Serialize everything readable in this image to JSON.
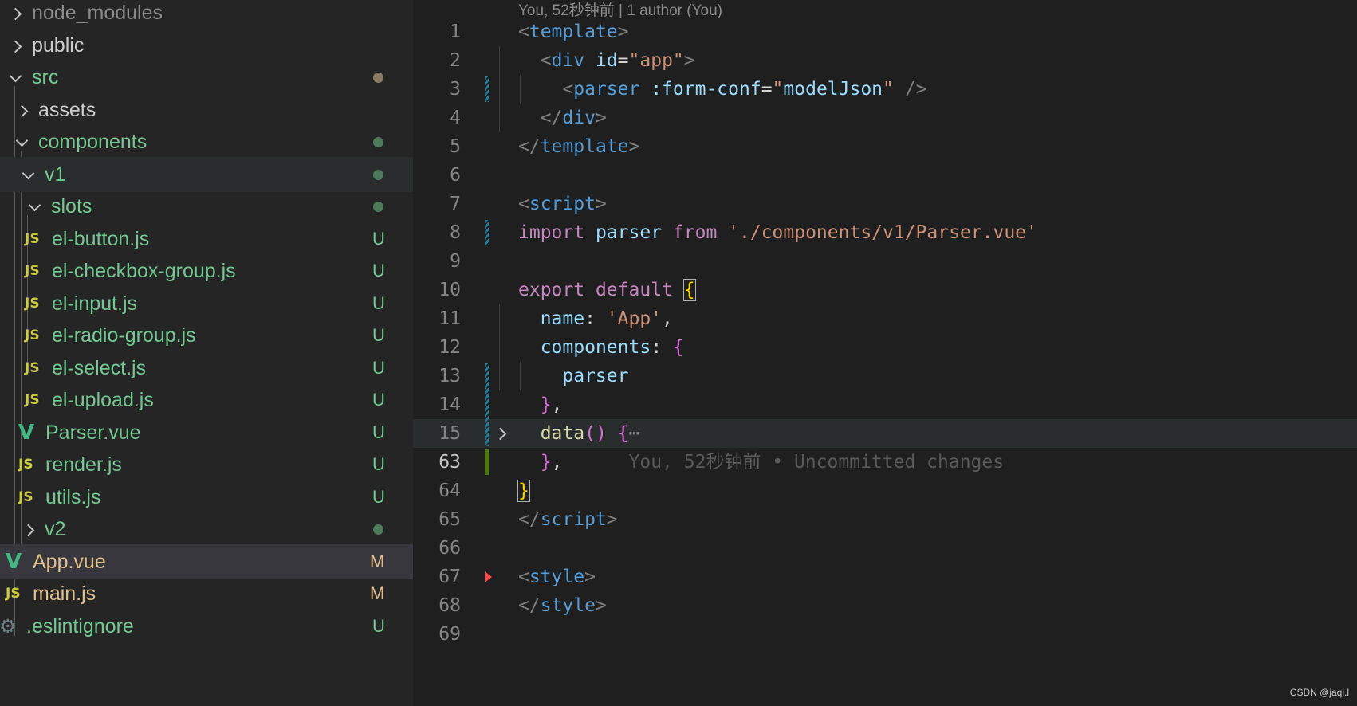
{
  "explorer": {
    "items": [
      {
        "label": "node_modules",
        "kind": "folder",
        "expanded": false,
        "status": "",
        "color": "#8b8b8b"
      },
      {
        "label": "public",
        "kind": "folder",
        "expanded": false,
        "status": "",
        "color": "#cccccc"
      },
      {
        "label": "src",
        "kind": "folder",
        "expanded": true,
        "status": "dot",
        "color": "#73c991"
      },
      {
        "label": "assets",
        "kind": "folder",
        "expanded": false,
        "status": "",
        "color": "#cccccc"
      },
      {
        "label": "components",
        "kind": "folder",
        "expanded": true,
        "status": "dot",
        "color": "#73c991"
      },
      {
        "label": "v1",
        "kind": "folder",
        "expanded": true,
        "status": "dot",
        "color": "#73c991"
      },
      {
        "label": "slots",
        "kind": "folder",
        "expanded": true,
        "status": "dot",
        "color": "#73c991"
      },
      {
        "label": "el-button.js",
        "kind": "js",
        "status": "U",
        "color": "#73c991"
      },
      {
        "label": "el-checkbox-group.js",
        "kind": "js",
        "status": "U",
        "color": "#73c991"
      },
      {
        "label": "el-input.js",
        "kind": "js",
        "status": "U",
        "color": "#73c991"
      },
      {
        "label": "el-radio-group.js",
        "kind": "js",
        "status": "U",
        "color": "#73c991"
      },
      {
        "label": "el-select.js",
        "kind": "js",
        "status": "U",
        "color": "#73c991"
      },
      {
        "label": "el-upload.js",
        "kind": "js",
        "status": "U",
        "color": "#73c991"
      },
      {
        "label": "Parser.vue",
        "kind": "vue",
        "status": "U",
        "color": "#73c991"
      },
      {
        "label": "render.js",
        "kind": "js",
        "status": "U",
        "color": "#73c991"
      },
      {
        "label": "utils.js",
        "kind": "js",
        "status": "U",
        "color": "#73c991"
      },
      {
        "label": "v2",
        "kind": "folder",
        "expanded": false,
        "status": "dot",
        "color": "#73c991"
      },
      {
        "label": "App.vue",
        "kind": "vue",
        "status": "M",
        "color": "#e2c08d"
      },
      {
        "label": "main.js",
        "kind": "js",
        "status": "M",
        "color": "#e2c08d"
      },
      {
        "label": ".eslintignore",
        "kind": "config",
        "status": "U",
        "color": "#73c991"
      }
    ],
    "icons": {
      "js": "JS",
      "vue": "V",
      "config": "⚙"
    }
  },
  "editor": {
    "blame_header": "You, 52秒钟前 | 1 author (You)",
    "inline_blame": "You, 52秒钟前 • Uncommitted changes",
    "line_numbers": [
      "1",
      "2",
      "3",
      "4",
      "5",
      "6",
      "7",
      "8",
      "9",
      "10",
      "11",
      "12",
      "13",
      "14",
      "15",
      "63",
      "64",
      "65",
      "66",
      "67",
      "68",
      "69"
    ],
    "fold_ellipsis": "⋯"
  },
  "watermark": "CSDN @jaqi.l",
  "colors": {
    "sidebar_bg": "#252526",
    "editor_bg": "#1f1f1f",
    "untracked": "#73c991",
    "modified": "#e2c08d",
    "git_added": "#487e02",
    "git_modified": "#1b81a8",
    "git_deleted": "#f14c4c"
  }
}
